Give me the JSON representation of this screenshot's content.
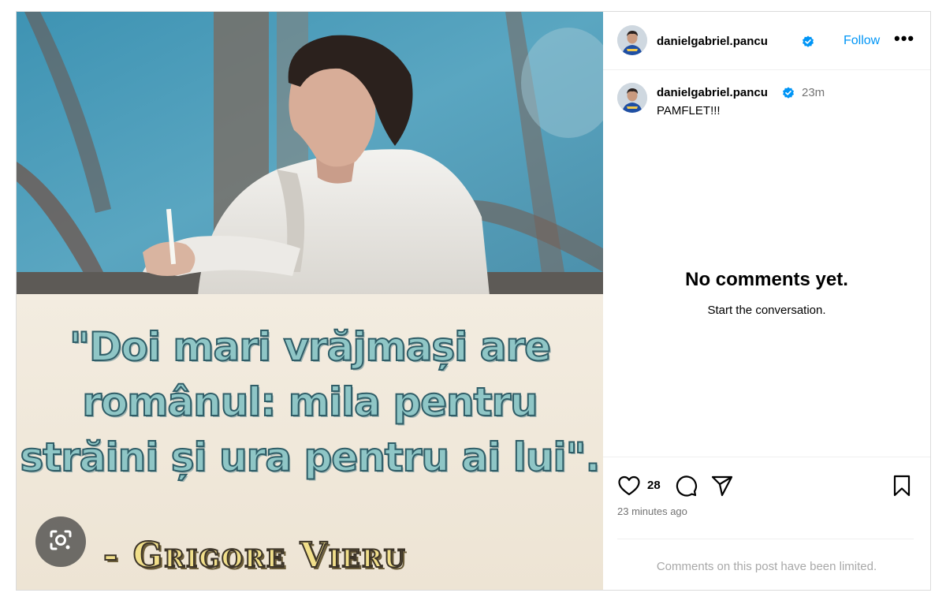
{
  "post": {
    "quote_lines": [
      "\"Doi mari vrăjmași are",
      "românul: mila pentru",
      "străini și ura pentru ai lui\"."
    ],
    "author": "- Grigore Vieru"
  },
  "header": {
    "username": "danielgabriel.pancu",
    "follow_label": "Follow",
    "more_label": "•••"
  },
  "caption": {
    "username": "danielgabriel.pancu",
    "time": "23m",
    "text": "PAMFLET!!!"
  },
  "comments": {
    "empty_title": "No comments yet.",
    "empty_subtitle": "Start the conversation."
  },
  "actions": {
    "like_count": "28",
    "timestamp": "23 minutes ago",
    "limited_notice": "Comments on this post have been limited."
  },
  "colors": {
    "accent": "#0095f6",
    "verified": "#0095f6",
    "muted": "#737373"
  },
  "icons": [
    "google-lens-icon",
    "verified-badge-icon",
    "heart-icon",
    "comment-icon",
    "share-icon",
    "bookmark-icon"
  ]
}
